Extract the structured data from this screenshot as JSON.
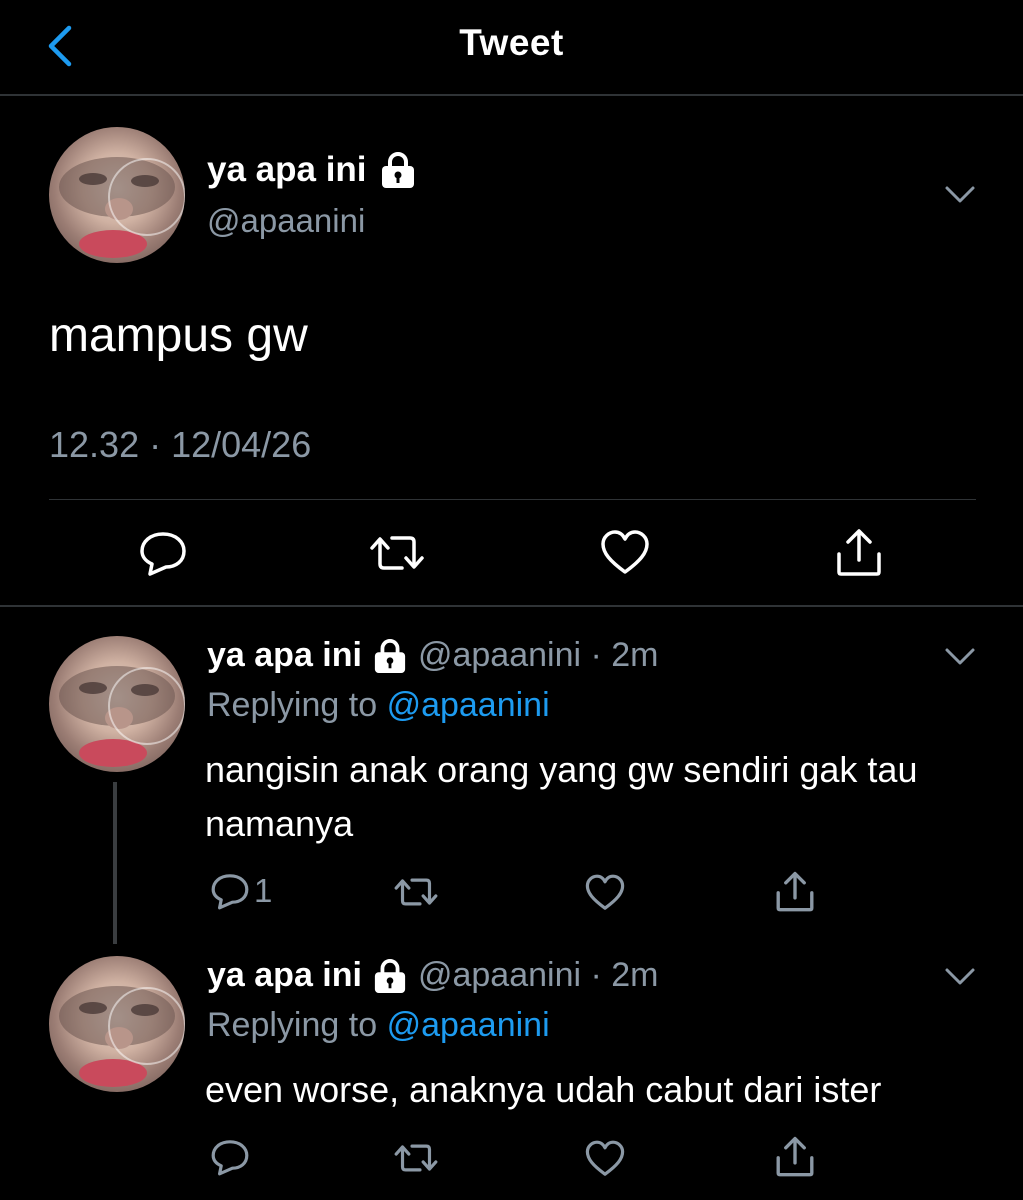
{
  "header": {
    "title": "Tweet"
  },
  "main_tweet": {
    "display_name": "ya apa ini",
    "handle": "@apaanini",
    "text": "mampus gw",
    "timestamp": "12.32 · 12/04/26"
  },
  "replies": [
    {
      "display_name": "ya apa ini",
      "meta": "@apaanini · 2m",
      "replying_prefix": "Replying to",
      "replying_to": "@apaanini",
      "text": "nangisin anak orang yang gw sendiri gak tau namanya",
      "reply_count": "1"
    },
    {
      "display_name": "ya apa ini",
      "meta": "@apaanini · 2m",
      "replying_prefix": "Replying to",
      "replying_to": "@apaanini",
      "text": "even worse, anaknya udah cabut dari ister",
      "reply_count": ""
    }
  ],
  "colors": {
    "background": "#000000",
    "accent": "#1d9bf0",
    "secondary_text": "#8b98a5",
    "divider": "#2f3336"
  },
  "icons": [
    "chevron-left-icon",
    "lock-icon",
    "chevron-down-icon",
    "reply-icon",
    "retweet-icon",
    "like-icon",
    "share-icon"
  ]
}
